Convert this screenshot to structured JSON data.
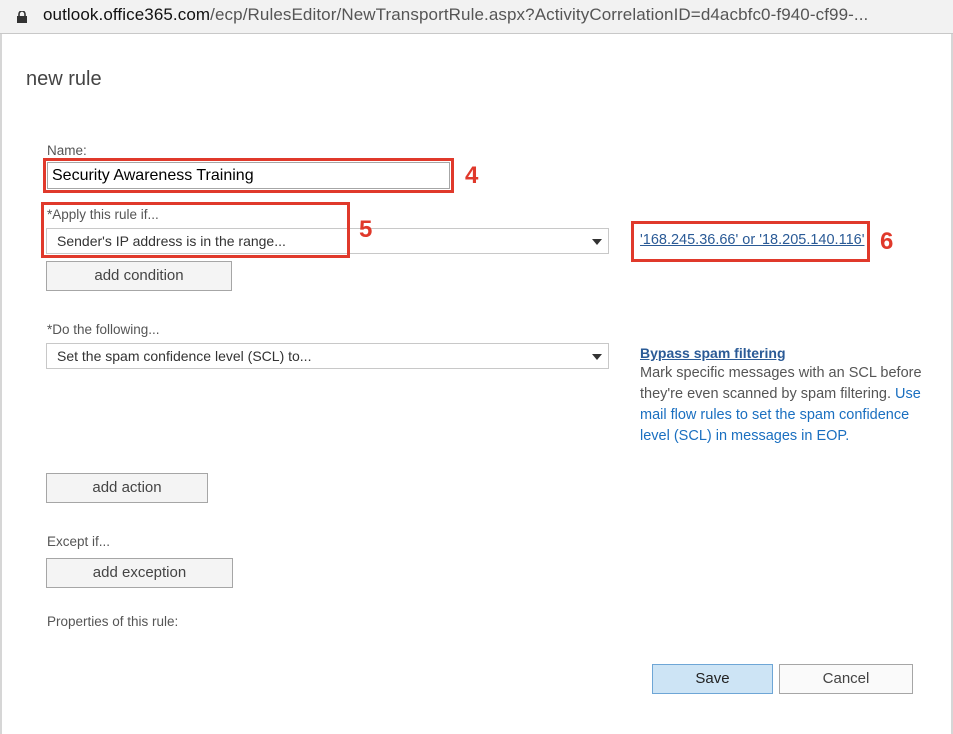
{
  "browser": {
    "url_domain": "outlook.office365.com",
    "url_path": "/ecp/RulesEditor/NewTransportRule.aspx?ActivityCorrelationID=d4acbfc0-f940-cf99-..."
  },
  "dialog": {
    "title": "new rule",
    "name_label": "Name:",
    "name_value": "Security Awareness Training",
    "apply_label": "*Apply this rule if...",
    "apply_value": "Sender's IP address is in the range...",
    "add_condition": "add condition",
    "ip_range_link": "'168.245.36.66' or '18.205.140.116'",
    "do_label": "*Do the following...",
    "do_value": "Set the spam confidence level (SCL) to...",
    "action_link": "Bypass spam filtering",
    "help_text": "Mark specific messages with an SCL before they're even scanned by spam filtering. ",
    "help_link": "Use mail flow rules to set the spam confidence level (SCL) in messages in EOP.",
    "add_action": "add action",
    "except_label": "Except if...",
    "add_exception": "add exception",
    "properties_label": "Properties of this rule:",
    "save": "Save",
    "cancel": "Cancel"
  },
  "callouts": [
    "4",
    "5",
    "6"
  ],
  "colors": {
    "callout": "#e0392b",
    "link": "#2a5a96",
    "save_bg": "#cde4f5"
  }
}
